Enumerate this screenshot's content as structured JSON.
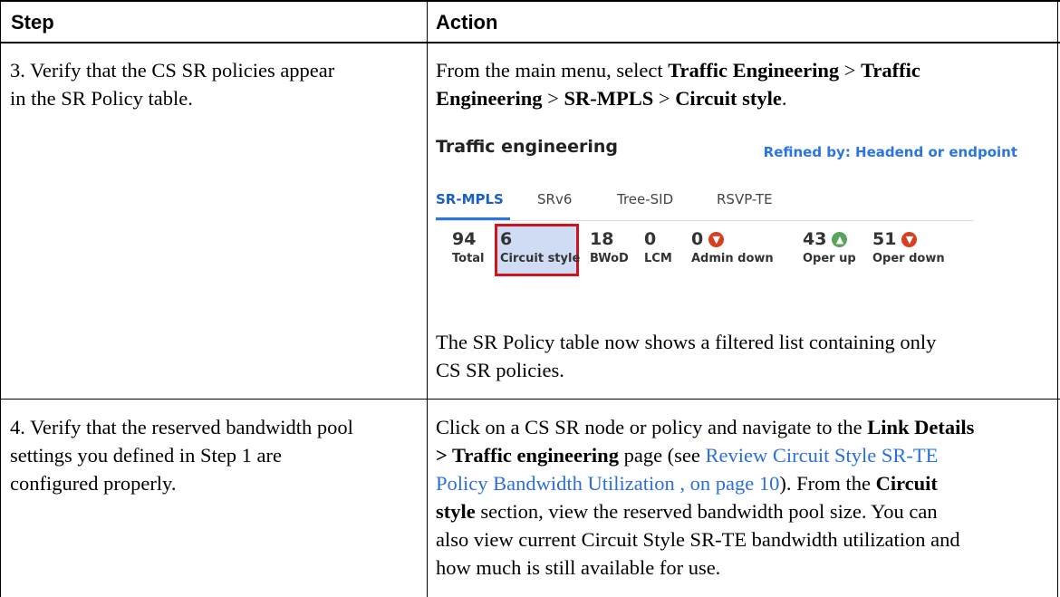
{
  "table": {
    "headers": [
      "Step",
      "Action"
    ],
    "rows": [
      {
        "step_lines": [
          "3. Verify that the CS SR policies appear",
          "in the SR Policy table."
        ],
        "action_intro": {
          "line1": [
            {
              "t": "From the main menu, select ",
              "b": false
            },
            {
              "t": "Traffic Engineering",
              "b": true
            },
            {
              "t": " > ",
              "b": false
            },
            {
              "t": "Traffic",
              "b": true
            }
          ],
          "line2": [
            {
              "t": "Engineering",
              "b": true
            },
            {
              "t": " > ",
              "b": false
            },
            {
              "t": "SR-MPLS",
              "b": true
            },
            {
              "t": " > ",
              "b": false
            },
            {
              "t": "Circuit style",
              "b": true
            },
            {
              "t": ".",
              "b": false
            }
          ]
        },
        "action_outro_lines": [
          "The SR Policy table now shows a filtered list containing only",
          "CS SR policies."
        ]
      },
      {
        "step_lines": [
          "4. Verify that the reserved bandwidth pool",
          "settings you defined in Step 1 are",
          "configured properly."
        ],
        "action_lines": [
          [
            {
              "t": "Click on a CS SR node or policy and navigate to the ",
              "b": false
            },
            {
              "t": "Link Details",
              "b": true
            }
          ],
          [
            {
              "t": "> Traffic engineering",
              "b": true
            },
            {
              "t": " page (see ",
              "b": false
            },
            {
              "t": "Review Circuit Style SR-TE",
              "b": false,
              "link": true
            }
          ],
          [
            {
              "t": "Policy Bandwidth Utilization , on page 10",
              "b": false,
              "link": true
            },
            {
              "t": "). From the ",
              "b": false
            },
            {
              "t": "Circuit",
              "b": true
            }
          ],
          [
            {
              "t": "style",
              "b": true
            },
            {
              "t": " section, view the reserved bandwidth pool size. You can",
              "b": false
            }
          ],
          [
            {
              "t": "also view current Circuit Style SR-TE bandwidth utilization and",
              "b": false
            }
          ],
          [
            {
              "t": "how much is still available for use.",
              "b": false
            }
          ]
        ]
      }
    ]
  },
  "te_panel": {
    "title": "Traffic engineering",
    "refined": "Refined by: Headend or endpoint",
    "tabs": [
      "SR-MPLS",
      "SRv6",
      "Tree-SID",
      "RSVP-TE"
    ],
    "active_tab": "SR-MPLS",
    "stats": [
      {
        "value": "94",
        "label": "Total",
        "icon": ""
      },
      {
        "value": "6",
        "label": "Circuit style",
        "icon": "",
        "highlight": true
      },
      {
        "value": "18",
        "label": "BWoD",
        "icon": ""
      },
      {
        "value": "0",
        "label": "LCM",
        "icon": ""
      },
      {
        "value": "0",
        "label": "Admin down",
        "icon": "arrow-down-circle-icon"
      },
      {
        "value": "43",
        "label": "Oper up",
        "icon": "arrow-up-circle-icon"
      },
      {
        "value": "51",
        "label": "Oper down",
        "icon": "arrow-down-circle-icon"
      }
    ],
    "colors": {
      "accent": "#2a75e0",
      "down": "#d6401e",
      "up": "#57a55a",
      "highlight_border": "#d0141c",
      "highlight_fill": "#cfdcf3"
    }
  }
}
